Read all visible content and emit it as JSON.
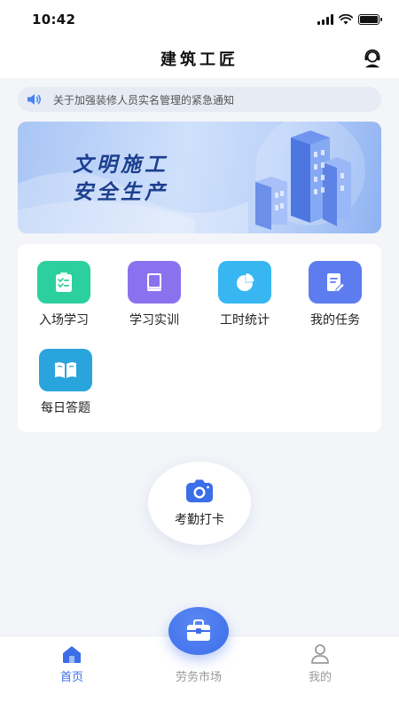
{
  "status_bar": {
    "time": "10:42"
  },
  "app_bar": {
    "title": "建筑工匠"
  },
  "notice": {
    "text": "关于加强装修人员实名管理的紧急通知"
  },
  "banner": {
    "line1": "文明施工",
    "line2": "安全生产"
  },
  "features": [
    {
      "label": "入场学习",
      "icon": "clipboard-icon",
      "color": "#2ccf9e"
    },
    {
      "label": "学习实训",
      "icon": "book-icon",
      "color": "#8a72ef"
    },
    {
      "label": "工时统计",
      "icon": "pie-chart-icon",
      "color": "#37b6f2"
    },
    {
      "label": "我的任务",
      "icon": "edit-note-icon",
      "color": "#5c7cf0"
    },
    {
      "label": "每日答题",
      "icon": "open-book-icon",
      "color": "#2aa4dc"
    }
  ],
  "checkin": {
    "label": "考勤打卡",
    "icon": "camera-icon"
  },
  "tabbar": {
    "items": [
      {
        "label": "首页",
        "icon": "home-icon",
        "active": true
      },
      {
        "label": "劳务市场",
        "icon": "toolbox-icon",
        "active": false
      },
      {
        "label": "我的",
        "icon": "person-icon",
        "active": false
      }
    ],
    "active_color": "#3b6ee8",
    "inactive_color": "#999999"
  }
}
